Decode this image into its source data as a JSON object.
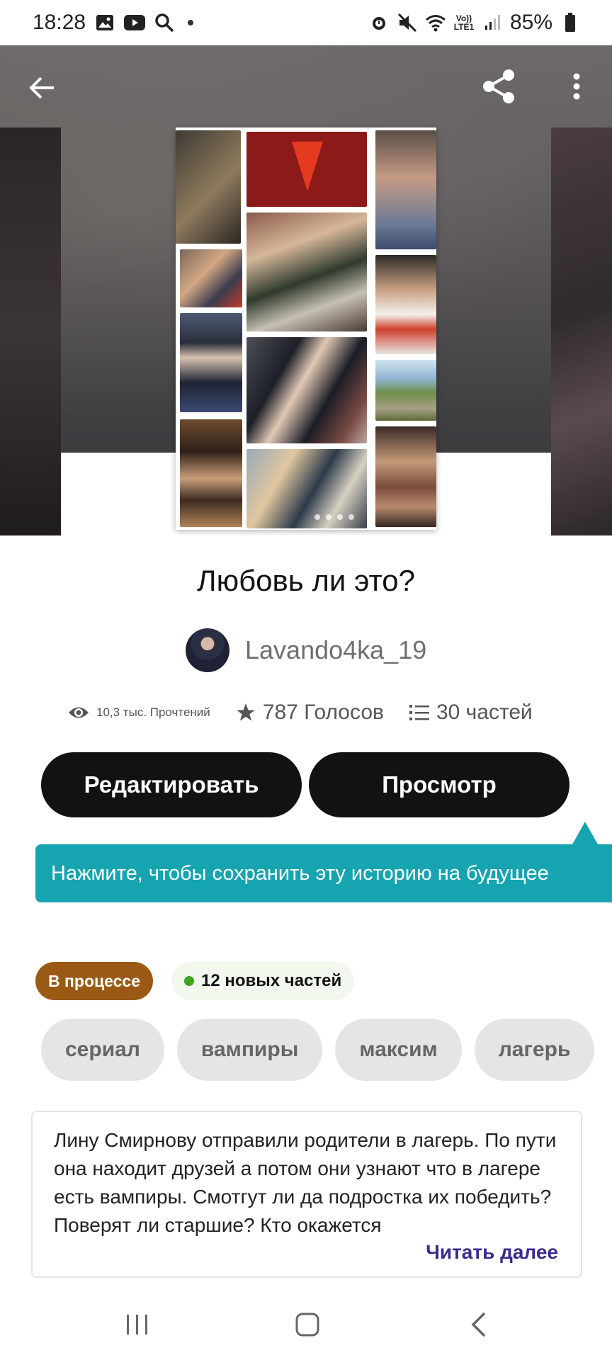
{
  "status_bar": {
    "time": "18:28",
    "battery": "85%",
    "volte_top": "Vo))",
    "volte_bottom": "LTE1",
    "left_icons": [
      "gallery-icon",
      "youtube-icon",
      "search-icon",
      "dot"
    ],
    "right_icons": [
      "alarm-icon",
      "mute-icon",
      "wifi-icon",
      "volte-icon",
      "signal-icon",
      "battery-icon"
    ]
  },
  "header": {
    "icons": [
      "back-arrow-icon",
      "share-icon",
      "more-vert-icon"
    ]
  },
  "story": {
    "title": "Любовь ли это?",
    "author": "Lavando4ka_19",
    "reads": "10,3 тыс. Прочтений",
    "votes": "787 Голосов",
    "parts": "30 частей"
  },
  "buttons": {
    "edit": "Редактировать",
    "view": "Просмотр"
  },
  "tooltip": {
    "text": "Нажмите, чтобы сохранить эту историю на будущее"
  },
  "badges": {
    "status": "В процессе",
    "new_parts": "12 новых частей"
  },
  "tags": [
    "сериал",
    "вампиры",
    "максим",
    "лагерь"
  ],
  "description": {
    "text": "Лину Смирнову отправили родители в лагерь. По пути она находит друзей а потом они узнают что в лагере есть вампиры. Смотгут ли да подростка их победить? Поверят ли старшие? Кто окажется",
    "read_more": "Читать далее"
  },
  "colors": {
    "primary_button": "#121212",
    "tooltip": "#15a4b0",
    "status_badge": "#9a5a15",
    "new_parts_dot": "#3da51e",
    "read_more": "#3d2a8c",
    "tag_bg": "#e5e5e7"
  }
}
